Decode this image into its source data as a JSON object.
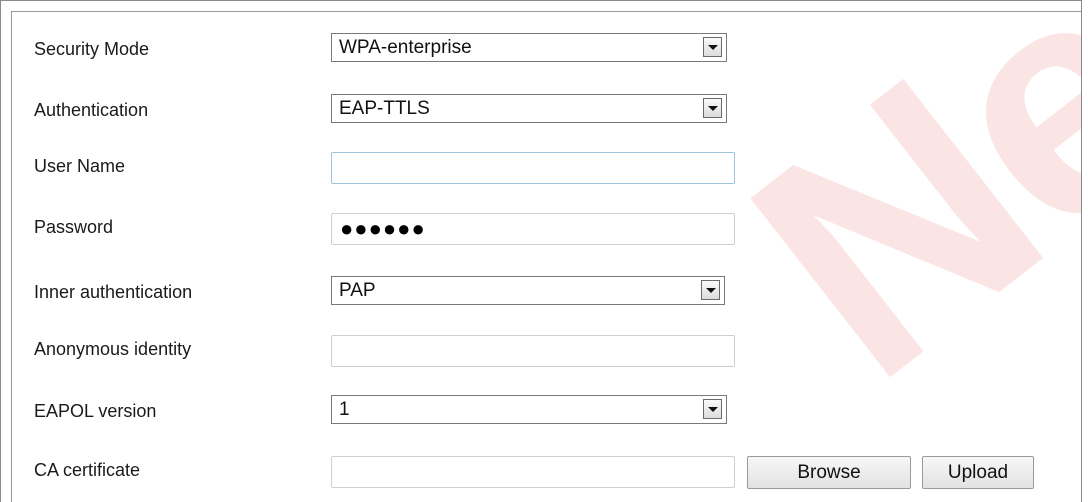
{
  "form": {
    "security_mode": {
      "label": "Security Mode",
      "value": "WPA-enterprise"
    },
    "authentication": {
      "label": "Authentication",
      "value": "EAP-TTLS"
    },
    "user_name": {
      "label": "User Name",
      "value": ""
    },
    "password": {
      "label": "Password",
      "masked_value": "●●●●●●"
    },
    "inner_authentication": {
      "label": "Inner authentication",
      "value": "PAP"
    },
    "anonymous_identity": {
      "label": "Anonymous identity",
      "value": ""
    },
    "eapol_version": {
      "label": "EAPOL version",
      "value": "1"
    },
    "ca_certificate": {
      "label": "CA certificate",
      "value": "",
      "browse_label": "Browse",
      "upload_label": "Upload"
    }
  },
  "watermark": "Net",
  "colors": {
    "watermark": "#e23a3a",
    "focus_border": "#9fc3db"
  }
}
